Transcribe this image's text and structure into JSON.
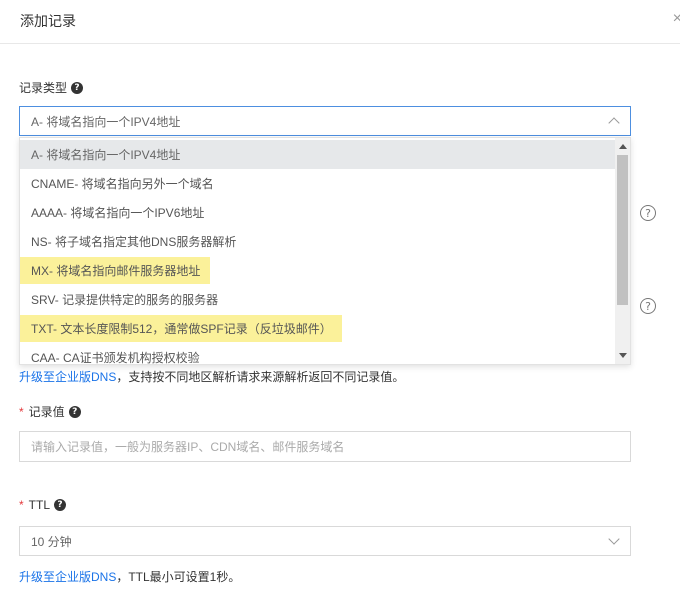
{
  "header": {
    "title": "添加记录",
    "close_icon": "close-icon"
  },
  "record_type": {
    "label": "记录类型",
    "selected": "A- 将域名指向一个IPV4地址",
    "options": [
      "A- 将域名指向一个IPV4地址",
      "CNAME- 将域名指向另外一个域名",
      "AAAA- 将域名指向一个IPV6地址",
      "NS- 将子域名指定其他DNS服务器解析",
      "MX- 将域名指向邮件服务器地址",
      "SRV- 记录提供特定的服务的服务器",
      "TXT- 文本长度限制512，通常做SPF记录（反垃圾邮件）",
      "CAA- CA证书颁发机构授权校验"
    ],
    "highlighted_options": [
      "MX- 将域名指向邮件服务器地址",
      "TXT- 文本长度限制512，通常做SPF记录（反垃圾邮件）"
    ]
  },
  "line_hint": {
    "link": "升级至企业版DNS",
    "text": "，支持按不同地区解析请求来源解析返回不同记录值。"
  },
  "record_value": {
    "label": "记录值",
    "required_mark": "*",
    "placeholder": "请输入记录值，一般为服务器IP、CDN域名、邮件服务域名"
  },
  "ttl": {
    "label": "TTL",
    "required_mark": "*",
    "selected": "10 分钟",
    "hint_link": "升级至企业版DNS",
    "hint_text": "，TTL最小可设置1秒。"
  },
  "help_symbol": "?",
  "colors": {
    "accent": "#1a73e8",
    "required": "#e4393c",
    "highlight": "#fbf19a",
    "focus_border": "#4d8fe0"
  }
}
